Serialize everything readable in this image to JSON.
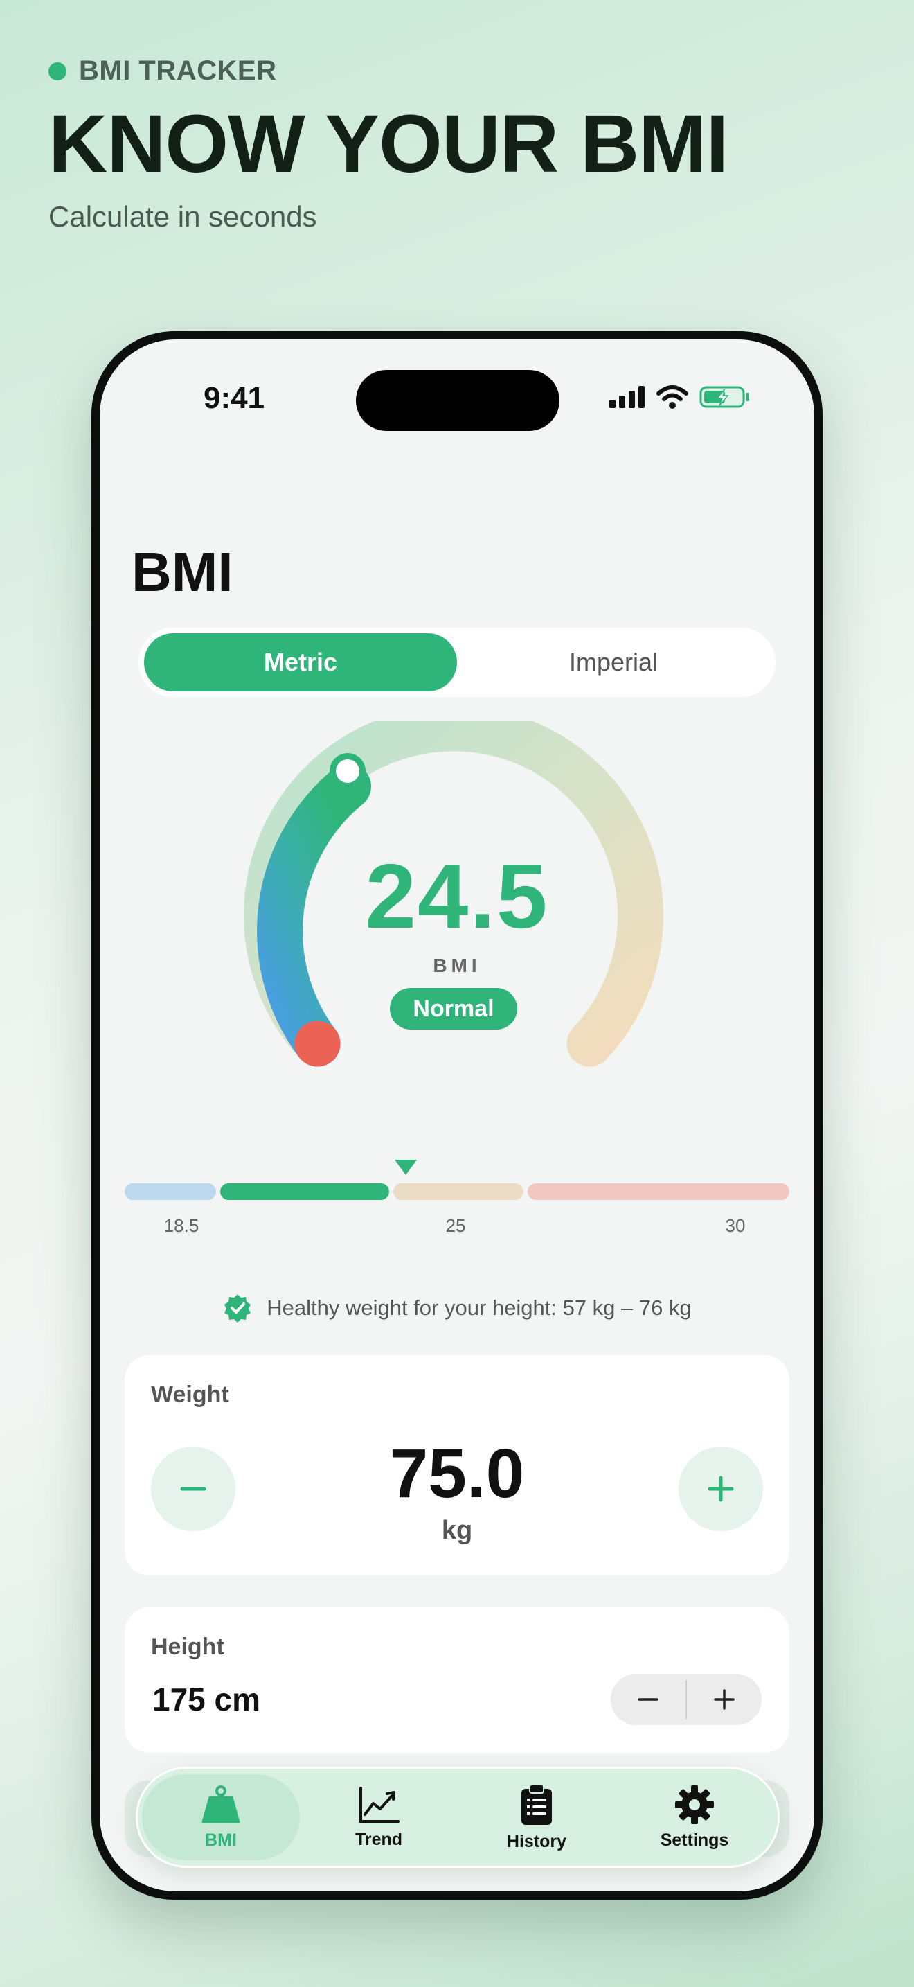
{
  "hero": {
    "tag": "BMI TRACKER",
    "headline": "KNOW YOUR BMI",
    "subline": "Calculate in seconds"
  },
  "status": {
    "time": "9:41"
  },
  "screen": {
    "title": "BMI",
    "units": {
      "options": [
        "Metric",
        "Imperial"
      ],
      "selected": "Metric"
    }
  },
  "gauge": {
    "value": "24.5",
    "label": "BMI",
    "status": "Normal"
  },
  "scale": {
    "ticks": [
      "18.5",
      "25",
      "30"
    ]
  },
  "healthy_range": "Healthy weight for your height: 57 kg – 76 kg",
  "weight": {
    "label": "Weight",
    "value": "75.0",
    "unit": "kg"
  },
  "height": {
    "label": "Height",
    "value": "175 cm"
  },
  "tabs": [
    {
      "label": "BMI",
      "icon": "weight-icon"
    },
    {
      "label": "Trend",
      "icon": "chart-icon"
    },
    {
      "label": "History",
      "icon": "clipboard-icon"
    },
    {
      "label": "Settings",
      "icon": "gear-icon"
    }
  ],
  "colors": {
    "accent": "#2fb57a",
    "underweight": "#bcd8ee",
    "overweight": "#eadcc6",
    "obese": "#f2c6c3"
  }
}
